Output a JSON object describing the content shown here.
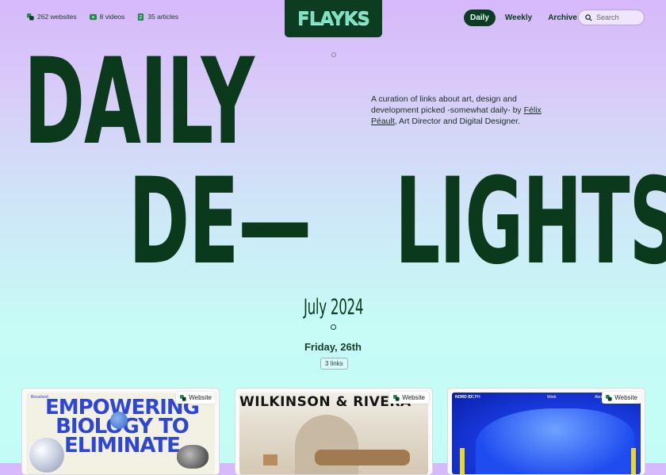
{
  "stats": [
    {
      "icon": "websites-icon",
      "text": "262 websites"
    },
    {
      "icon": "video-icon",
      "text": "8 videos"
    },
    {
      "icon": "article-icon",
      "text": "35 articles"
    }
  ],
  "logo": {
    "text": "FLAYKS"
  },
  "nav": [
    {
      "label": "Daily",
      "active": true
    },
    {
      "label": "Weekly",
      "active": false
    },
    {
      "label": "Archive",
      "active": false
    }
  ],
  "search": {
    "placeholder": "Search"
  },
  "hero": {
    "line1": "DAILY",
    "line2a": "DE—",
    "line2b": "LIGHTS"
  },
  "intro": {
    "text_before": "A curation of links about art, design and development picked -somewhat daily- by ",
    "author": "Félix Péault",
    "text_after": ", Art Director and Digital Designer."
  },
  "month": "July 2024",
  "day": "Friday, 26th",
  "link_count": "3 links",
  "cards": [
    {
      "badge": "Website",
      "preview_text": "EMPOWERING BIOLOGY TO ELIMINATE",
      "tag": "Biosolved"
    },
    {
      "badge": "Website",
      "preview_text": "WILKINSON & RIVERA"
    },
    {
      "badge": "Website",
      "tags": [
        "NORD ID",
        "CPH",
        "Work",
        "Abou"
      ]
    }
  ],
  "colors": {
    "accent": "#0c3d21",
    "logo_text": "#7fe0c4",
    "card1_text": "#2d46d6",
    "card3_bg": "#1b3ee6"
  }
}
